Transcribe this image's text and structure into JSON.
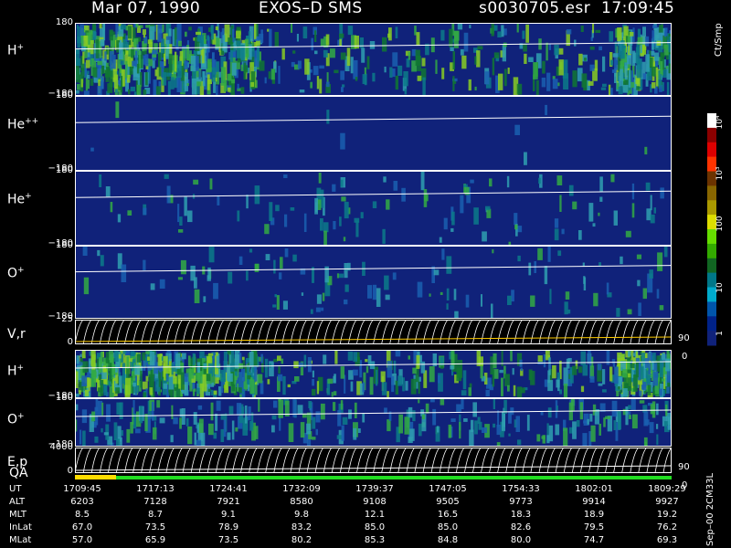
{
  "header": {
    "date": "Mar 07, 1990",
    "instrument": "EXOS–D SMS",
    "file": "s0030705.esr",
    "time": "17:09:45"
  },
  "colors": {
    "background": "#000000",
    "panel_bg": "#10227a",
    "axis": "#ffffff",
    "quality_bar_yellow": "#ffdd00",
    "quality_bar_green": "#22dd22"
  },
  "chart_data": [
    {
      "type": "heatmap",
      "name": "H",
      "superscript": "+",
      "ytick_top": "180",
      "ytick_bottom": "−180",
      "intensity": "high"
    },
    {
      "type": "heatmap",
      "name": "He",
      "superscript": "++",
      "ytick_top": "180",
      "ytick_bottom": "−180",
      "intensity": "none"
    },
    {
      "type": "heatmap",
      "name": "He",
      "superscript": "+",
      "ytick_top": "180",
      "ytick_bottom": "−180",
      "intensity": "low"
    },
    {
      "type": "heatmap",
      "name": "O",
      "superscript": "+",
      "ytick_top": "180",
      "ytick_bottom": "−180",
      "intensity": "low"
    },
    {
      "type": "line",
      "name": "V,r",
      "ytick_top": "25",
      "ytick_bottom": "0",
      "right_top": "90",
      "right_bottom": "0"
    },
    {
      "type": "heatmap",
      "name": "H",
      "superscript": "+",
      "ytick_top": "",
      "ytick_bottom": "−180",
      "intensity": "high"
    },
    {
      "type": "heatmap",
      "name": "O",
      "superscript": "+",
      "ytick_top": "180",
      "ytick_bottom": "−180",
      "intensity": "medium"
    },
    {
      "type": "line",
      "name": "E,p",
      "ytick_top": "4000",
      "ytick_bottom": "0",
      "right_top": "90",
      "right_bottom": "0"
    }
  ],
  "qa": {
    "label": "QA"
  },
  "colorbar": {
    "unit": "Ct/Smp",
    "ticks": [
      "10⁴",
      "10³",
      "100",
      "10",
      "1"
    ],
    "stops": [
      "#ffffff",
      "#8b0000",
      "#dd0000",
      "#ff3300",
      "#6b3300",
      "#886600",
      "#aa9900",
      "#dddd00",
      "#66dd00",
      "#33aa00",
      "#116622",
      "#007788",
      "#00aacc",
      "#0055aa",
      "#002288",
      "#10227a"
    ]
  },
  "side_text": "Sep–00  2CM33L",
  "time_table": {
    "rows": [
      {
        "label": "UT",
        "values": [
          "1709:45",
          "1717:13",
          "1724:41",
          "1732:09",
          "1739:37",
          "1747:05",
          "1754:33",
          "1802:01",
          "1809:29"
        ]
      },
      {
        "label": "ALT",
        "values": [
          "6203",
          "7128",
          "7921",
          "8580",
          "9108",
          "9505",
          "9773",
          "9914",
          "9927"
        ]
      },
      {
        "label": "MLT",
        "values": [
          "8.5",
          "8.7",
          "9.1",
          "9.8",
          "12.1",
          "16.5",
          "18.3",
          "18.9",
          "19.2"
        ]
      },
      {
        "label": "InLat",
        "values": [
          "67.0",
          "73.5",
          "78.9",
          "83.2",
          "85.0",
          "85.0",
          "82.6",
          "79.5",
          "76.2"
        ]
      },
      {
        "label": "MLat",
        "values": [
          "57.0",
          "65.9",
          "73.5",
          "80.2",
          "85.3",
          "84.8",
          "80.0",
          "74.7",
          "69.3"
        ]
      }
    ]
  }
}
